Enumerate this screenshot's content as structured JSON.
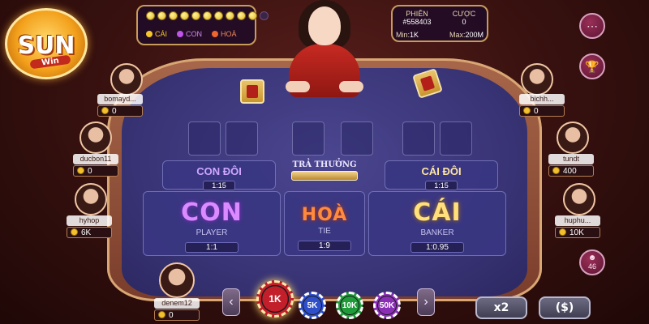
{
  "logo": {
    "text": "SUN",
    "sub": "Win"
  },
  "road": {
    "dots": [
      "filled",
      "filled",
      "filled",
      "filled",
      "filled",
      "filled",
      "filled",
      "filled",
      "filled",
      "filled",
      "empty"
    ],
    "legend": {
      "cai": "CÁI",
      "con": "CON",
      "hoa": "HOÀ"
    }
  },
  "info": {
    "phien_label": "PHIÊN",
    "phien_value": "#558403",
    "cuoc_label": "CƯỢC",
    "cuoc_value": "0",
    "min_label": "Min:",
    "min_value": "1K",
    "max_label": "Max:",
    "max_value": "200M"
  },
  "right_controls": {
    "online_count": "46"
  },
  "table": {
    "tra_thuong": "TRẢ THƯỞNG",
    "con_doi": {
      "title": "CON ĐÔI",
      "rate": "1:15"
    },
    "cai_doi": {
      "title": "CÁI ĐÔI",
      "rate": "1:15"
    },
    "con": {
      "title": "CON",
      "sub": "PLAYER",
      "rate": "1:1"
    },
    "hoa": {
      "title": "HOÀ",
      "sub": "TIE",
      "rate": "1:9"
    },
    "cai": {
      "title": "CÁI",
      "sub": "BANKER",
      "rate": "1:0.95"
    }
  },
  "players": {
    "left": [
      {
        "name": "bomayd...",
        "balance": "0"
      },
      {
        "name": "ducbon11",
        "balance": "0"
      },
      {
        "name": "hyhop",
        "balance": "6K"
      }
    ],
    "right": [
      {
        "name": "bichh...",
        "balance": "0"
      },
      {
        "name": "tundt",
        "balance": "400"
      },
      {
        "name": "huphu...",
        "balance": "10K"
      }
    ],
    "self": {
      "name": "denem12",
      "balance": "0"
    }
  },
  "chips": [
    {
      "label": "1K",
      "color": "#c21f2a"
    },
    {
      "label": "5K",
      "color": "#2e4fc9"
    },
    {
      "label": "10K",
      "color": "#1f9b3a"
    },
    {
      "label": "50K",
      "color": "#8a2fb5"
    }
  ],
  "actions": {
    "double": "x2",
    "rebet": "($)"
  },
  "colors": {
    "felt": "#3a3577",
    "rim": "#a8674a",
    "accent_gold": "#c79b5a"
  }
}
